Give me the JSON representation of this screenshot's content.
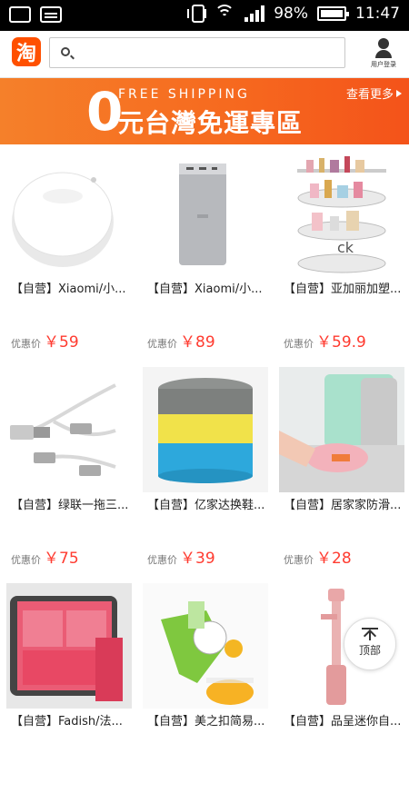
{
  "status_bar": {
    "battery": "98%",
    "battery_level": 0.98,
    "time": "11:47"
  },
  "header": {
    "logo_text": "淘",
    "search": {
      "value": "",
      "placeholder": ""
    },
    "user_label": "用户登录"
  },
  "banner": {
    "free_shipping": "FREE SHIPPING",
    "zero": "0",
    "title": "元台灣免運專區",
    "more": "查看更多"
  },
  "products": [
    {
      "title": "【自营】Xiaomi/小...",
      "price_label": "优惠价",
      "price": "￥59",
      "image": "night-light"
    },
    {
      "title": "【自营】Xiaomi/小...",
      "price_label": "优惠价",
      "price": "￥89",
      "image": "power-bank"
    },
    {
      "title": "【自营】亚加丽加塑...",
      "price_label": "优惠价",
      "price": "￥59.9",
      "image": "cosmetic-organizer"
    },
    {
      "title": "【自营】绿联一拖三...",
      "price_label": "优惠价",
      "price": "￥75",
      "image": "usb-cable"
    },
    {
      "title": "【自营】亿家达换鞋...",
      "price_label": "优惠价",
      "price": "￥39",
      "image": "stool"
    },
    {
      "title": "【自营】居家家防滑...",
      "price_label": "优惠价",
      "price": "￥28",
      "image": "cutting-board"
    },
    {
      "title": "【自营】Fadish/法...",
      "price_label": "",
      "price": "",
      "image": "travel-bags"
    },
    {
      "title": "【自营】美之扣简易...",
      "price_label": "",
      "price": "",
      "image": "juicer"
    },
    {
      "title": "【自营】品呈迷你自...",
      "price_label": "",
      "price": "",
      "image": "selfie-stick"
    }
  ],
  "back_to_top": {
    "label": "顶部"
  },
  "colors": {
    "brand": "#ff5000",
    "price": "#ff3b30",
    "banner": "#f66a1f"
  }
}
